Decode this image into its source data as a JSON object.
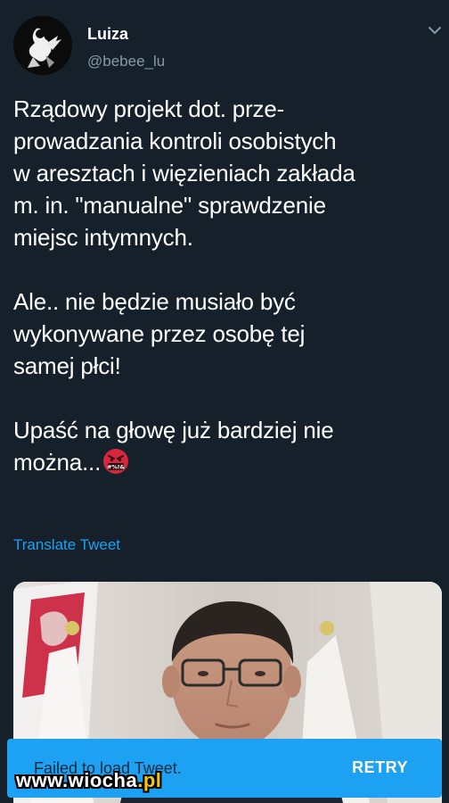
{
  "tweet": {
    "author": {
      "display_name": "Luiza",
      "handle": "@bebee_lu"
    },
    "text": "Rządowy projekt dot. prze-\nprowadzania kontroli osobistych\nw aresztach i więzieniach zakłada\nm. in. \"manualne\" sprawdzenie\nmiejsc intymnych.\n\nAle.. nie będzie musiało być\nwykonywane przez osobę tej\nsamej płci!\n\nUpaść na głowę już bardziej nie\nmożna...",
    "emoji_name": "face-with-symbols-on-mouth",
    "emoji_symbols": "#%!&",
    "translate_label": "Translate Tweet"
  },
  "snackbar": {
    "message": "Failed to load Tweet.",
    "action_label": "RETRY"
  },
  "watermark": {
    "text_main": "www.wiocha",
    "text_accent": ".pl"
  },
  "colors": {
    "background": "#15202b",
    "accent": "#1da1f2",
    "secondary_text": "#8899a6"
  }
}
